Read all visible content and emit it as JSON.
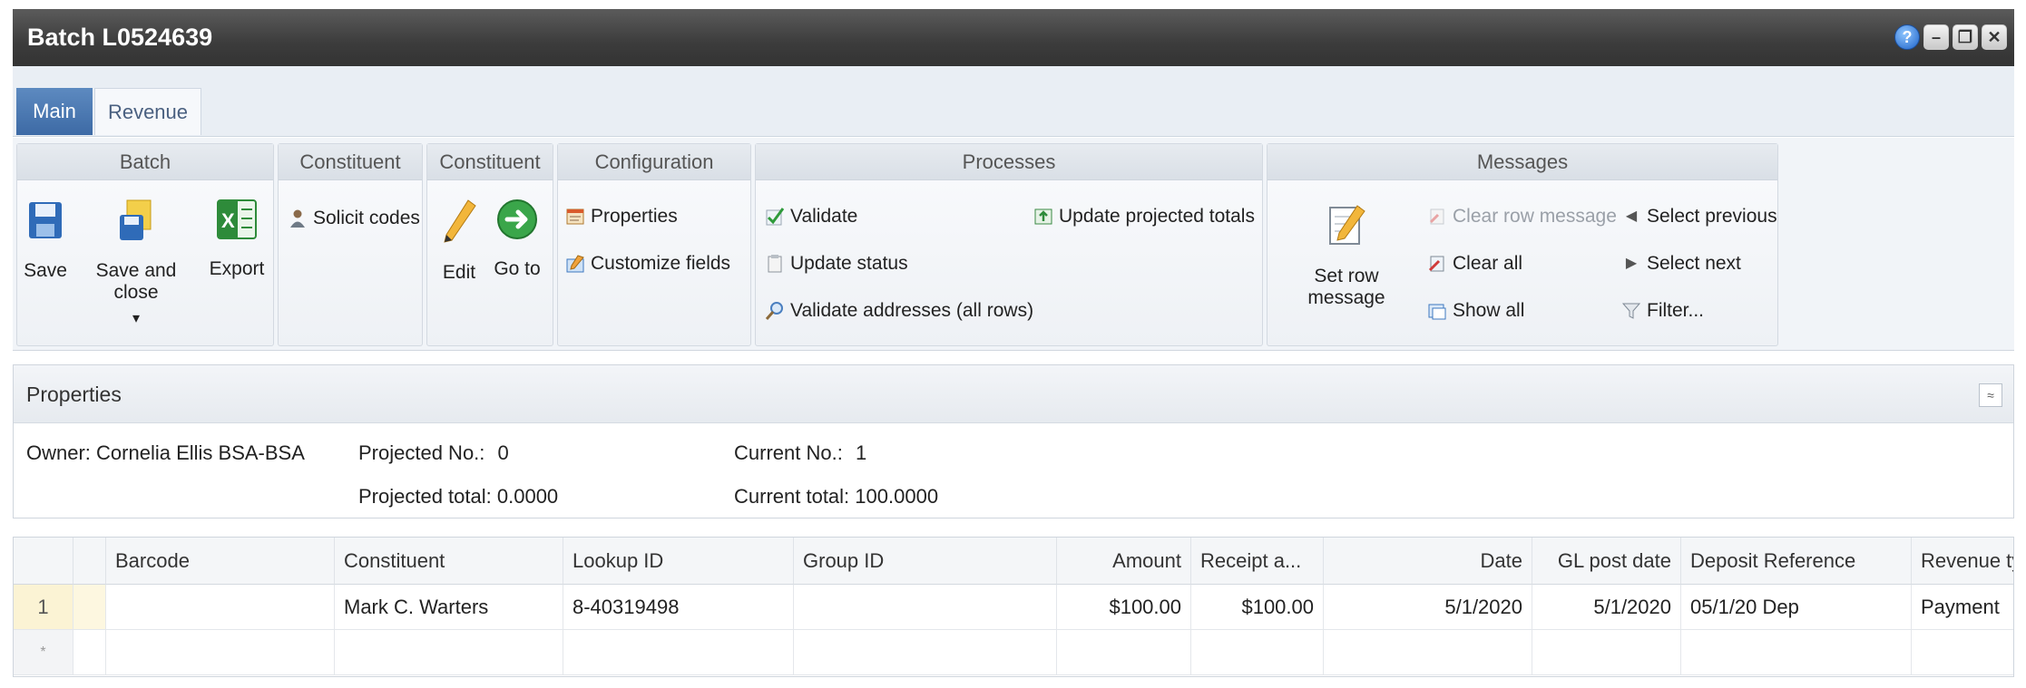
{
  "window": {
    "title": "Batch L0524639"
  },
  "tabs": [
    {
      "label": "Main"
    },
    {
      "label": "Revenue"
    }
  ],
  "ribbon": {
    "batch": {
      "title": "Batch",
      "save": "Save",
      "save_and_close": "Save and close",
      "save_and_close_arrow": "▾",
      "export": "Export"
    },
    "constituent1": {
      "title": "Constituent",
      "solicit_codes": "Solicit codes"
    },
    "constituent2": {
      "title": "Constituent",
      "edit": "Edit",
      "go_to": "Go to"
    },
    "configuration": {
      "title": "Configuration",
      "properties": "Properties",
      "customize_fields": "Customize fields"
    },
    "processes": {
      "title": "Processes",
      "validate": "Validate",
      "update_status": "Update status",
      "validate_addresses": "Validate addresses (all rows)",
      "update_projected_totals": "Update projected totals"
    },
    "messages": {
      "title": "Messages",
      "set_row_message": "Set row message",
      "clear_row_message": "Clear row message",
      "clear_all": "Clear all",
      "show_all": "Show all",
      "select_previous": "Select previous",
      "select_next": "Select next",
      "filter": "Filter..."
    }
  },
  "properties": {
    "title": "Properties",
    "collapse_glyph": "≈",
    "owner_label": "Owner:",
    "owner": "Cornelia Ellis BSA-BSA",
    "projected_no_label": "Projected No.:",
    "projected_no": "0",
    "projected_total_label": "Projected total:",
    "projected_total": "0.0000",
    "current_no_label": "Current No.:",
    "current_no": "1",
    "current_total_label": "Current total:",
    "current_total": "100.0000"
  },
  "grid": {
    "columns": [
      "Barcode",
      "Constituent",
      "Lookup ID",
      "Group ID",
      "Amount",
      "Receipt a...",
      "Date",
      "GL post date",
      "Deposit Reference",
      "Revenue ty"
    ],
    "rows": [
      {
        "row_no": "1",
        "barcode": "",
        "constituent": "Mark C. Warters",
        "lookup_id": "8-40319498",
        "group_id": "",
        "amount": "$100.00",
        "receipt_amount": "$100.00",
        "date": "5/1/2020",
        "gl_post_date": "5/1/2020",
        "deposit_reference": "05/1/20 Dep",
        "revenue_type": "Payment"
      }
    ],
    "new_row_marker": "*"
  },
  "colors": {
    "titlebar": "#3c3c3c",
    "tab_active": "#3d6aa5",
    "row_header": "#fbf3d4"
  }
}
